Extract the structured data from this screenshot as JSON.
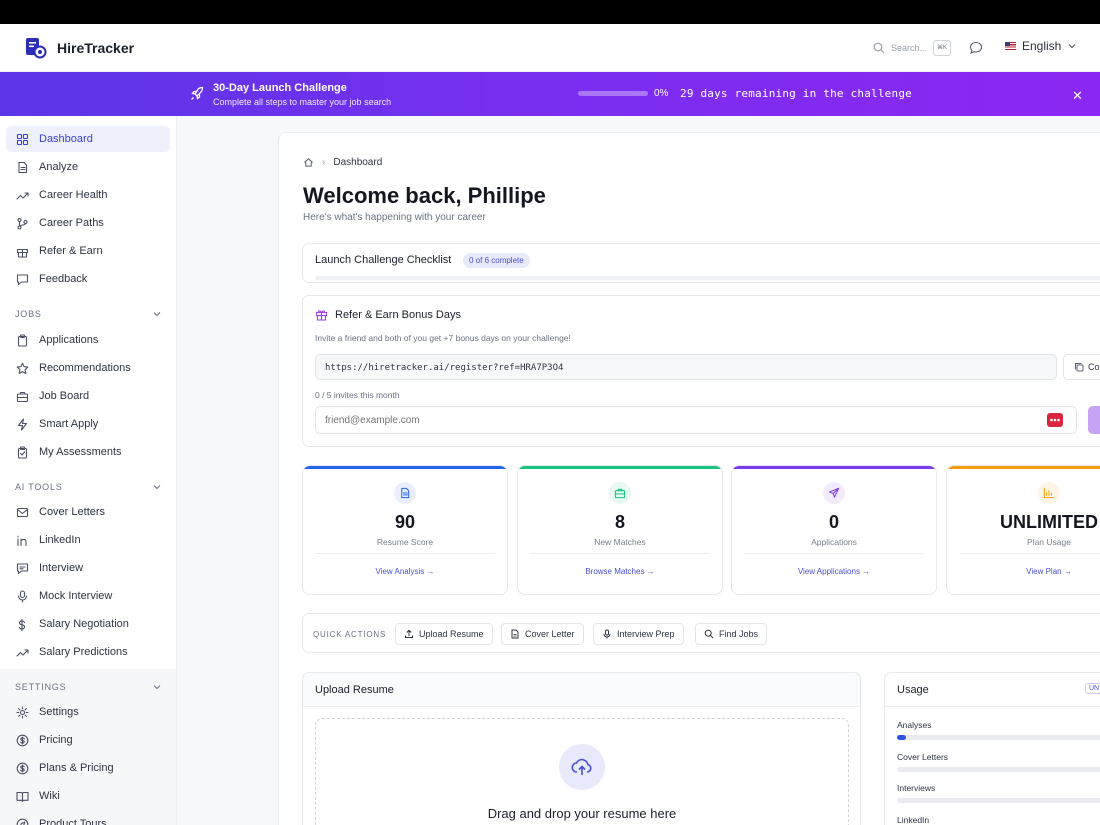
{
  "header": {
    "brand": "HireTracker",
    "search_placeholder": "Search...",
    "search_shortcut": "⌘K",
    "language": "English"
  },
  "banner": {
    "title": "30-Day Launch Challenge",
    "subtitle": "Complete all steps to master your job search",
    "progress_percent": 0,
    "progress_label": "0%",
    "remaining": "29 days remaining in the challenge"
  },
  "sidebar": {
    "main": [
      {
        "label": "Dashboard",
        "icon": "grid-icon",
        "active": true
      },
      {
        "label": "Analyze",
        "icon": "document-icon"
      },
      {
        "label": "Career Health",
        "icon": "trend-icon"
      },
      {
        "label": "Career Paths",
        "icon": "branch-icon"
      },
      {
        "label": "Refer & Earn",
        "icon": "gift-icon"
      },
      {
        "label": "Feedback",
        "icon": "message-icon"
      }
    ],
    "jobs_title": "JOBS",
    "jobs": [
      {
        "label": "Applications",
        "icon": "clipboard-icon"
      },
      {
        "label": "Recommendations",
        "icon": "star-icon"
      },
      {
        "label": "Job Board",
        "icon": "briefcase-icon"
      },
      {
        "label": "Smart Apply",
        "icon": "bolt-icon"
      },
      {
        "label": "My Assessments",
        "icon": "clipboard-check-icon"
      }
    ],
    "ai_title": "AI TOOLS",
    "ai": [
      {
        "label": "Cover Letters",
        "icon": "mail-icon"
      },
      {
        "label": "LinkedIn",
        "icon": "linkedin-icon"
      },
      {
        "label": "Interview",
        "icon": "chat-icon"
      },
      {
        "label": "Mock Interview",
        "icon": "mic-icon"
      },
      {
        "label": "Salary Negotiation",
        "icon": "dollar-icon"
      },
      {
        "label": "Salary Predictions",
        "icon": "trend-icon"
      }
    ],
    "settings_title": "SETTINGS",
    "settings": [
      {
        "label": "Settings",
        "icon": "gear-icon"
      },
      {
        "label": "Pricing",
        "icon": "dollar-circle-icon"
      },
      {
        "label": "Plans & Pricing",
        "icon": "dollar-circle-icon"
      },
      {
        "label": "Wiki",
        "icon": "book-icon"
      },
      {
        "label": "Product Tours",
        "icon": "compass-icon"
      }
    ]
  },
  "breadcrumb": {
    "current": "Dashboard"
  },
  "page": {
    "title": "Welcome back, Phillipe",
    "subtitle": "Here's what's happening with your career"
  },
  "checklist": {
    "title": "Launch Challenge Checklist",
    "badge": "0 of 6 complete"
  },
  "referral": {
    "title": "Refer & Earn Bonus Days",
    "description": "Invite a friend and both of you get +7 bonus days on your challenge!",
    "link": "https://hiretracker.ai/register?ref=HRA7P3O4",
    "copy_label": "Co",
    "invites": "0 / 5 invites this month",
    "email_placeholder": "friend@example.com"
  },
  "stats": [
    {
      "value": "90",
      "label": "Resume Score",
      "link": "View Analysis →",
      "color": "#2563eb",
      "icon": "document-icon"
    },
    {
      "value": "8",
      "label": "New Matches",
      "link": "Browse Matches →",
      "color": "#16c47f",
      "icon": "briefcase-icon"
    },
    {
      "value": "0",
      "label": "Applications",
      "link": "View Applications →",
      "color": "#7c3aed",
      "icon": "send-icon"
    },
    {
      "value": "UNLIMITED",
      "label": "Plan Usage",
      "link": "View Plan →",
      "color": "#f59e0b",
      "icon": "chart-icon"
    }
  ],
  "quick_actions": {
    "label": "QUICK ACTIONS",
    "buttons": [
      "Upload Resume",
      "Cover Letter",
      "Interview Prep",
      "Find Jobs"
    ]
  },
  "upload": {
    "title": "Upload Resume",
    "drop_text": "Drag and drop your resume here"
  },
  "usage": {
    "title": "Usage",
    "badge": "UN",
    "items": [
      {
        "label": "Analyses",
        "percent": 4
      },
      {
        "label": "Cover Letters",
        "percent": 0
      },
      {
        "label": "Interviews",
        "percent": 0
      },
      {
        "label": "LinkedIn",
        "percent": 0
      }
    ]
  },
  "colors": {
    "accent": "#4b4fd6",
    "banner_start": "#5b36e8",
    "banner_end": "#8b27f2"
  }
}
